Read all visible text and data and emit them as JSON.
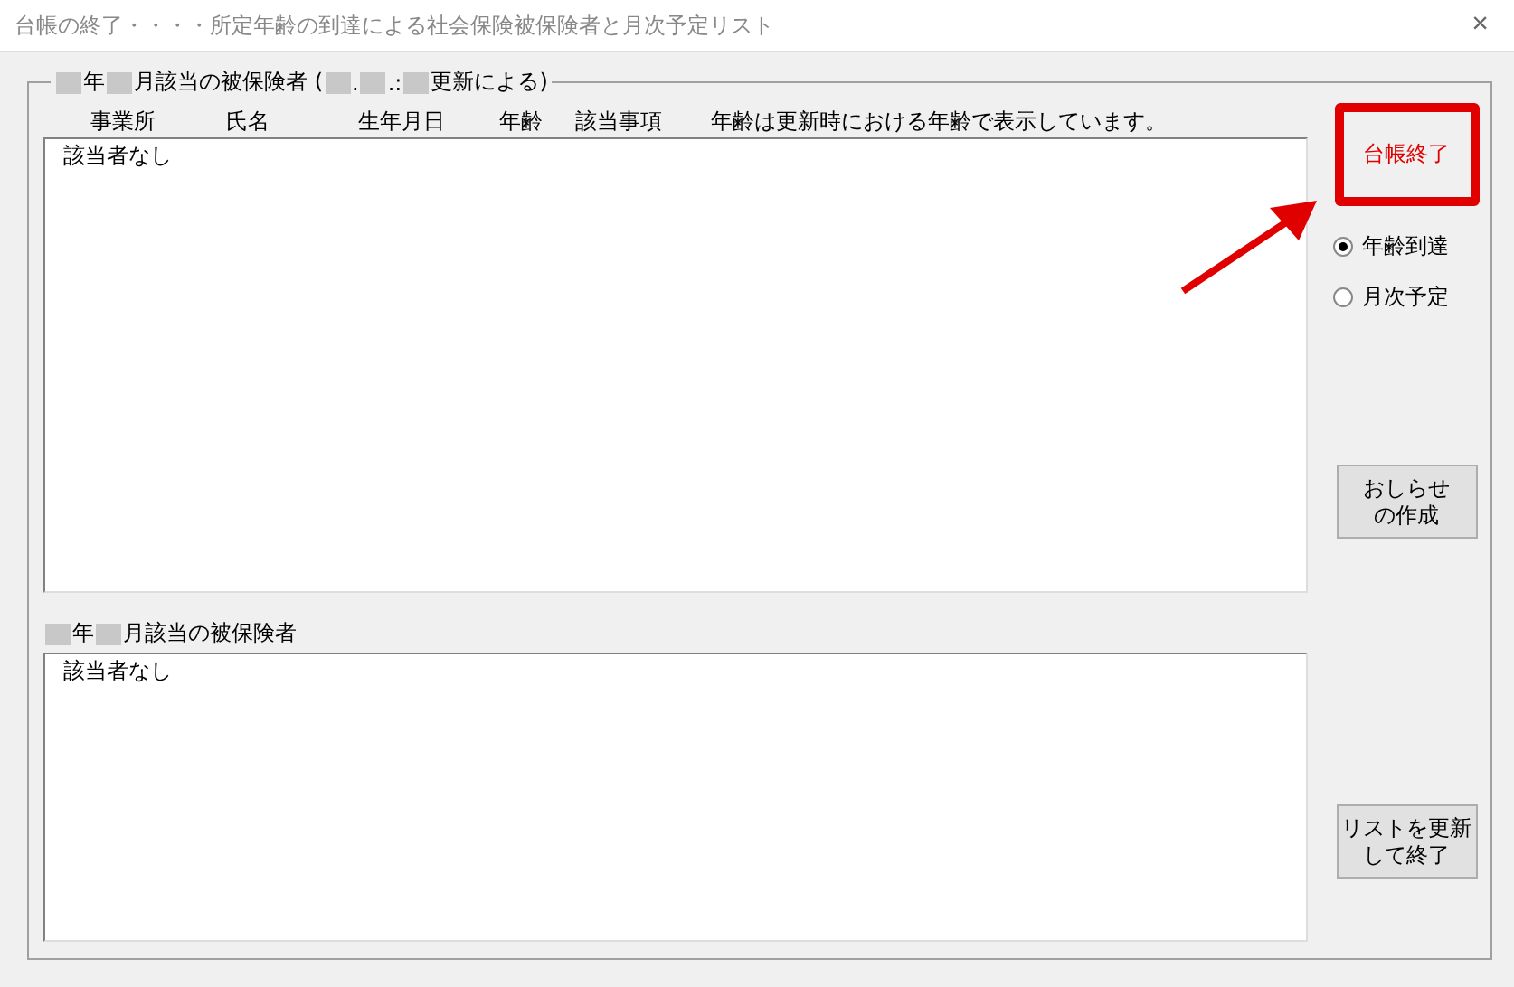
{
  "window": {
    "title": "台帳の終了・・・・所定年齢の到達による社会保険被保険者と月次予定リスト",
    "close": "×"
  },
  "upper_group": {
    "title_parts": [
      {
        "kind": "redacted"
      },
      {
        "kind": "text",
        "text": "年"
      },
      {
        "kind": "redacted"
      },
      {
        "kind": "text",
        "text": "月該当の被保険者 ("
      },
      {
        "kind": "redacted"
      },
      {
        "kind": "text",
        "text": "."
      },
      {
        "kind": "redacted"
      },
      {
        "kind": "text",
        "text": ".:"
      },
      {
        "kind": "redacted"
      },
      {
        "kind": "text",
        "text": "更新による)"
      }
    ],
    "columns": [
      "事業所",
      "氏名",
      "生年月日",
      "年齢",
      "該当事項"
    ],
    "note": "年齢は更新時における年齢で表示しています。",
    "list_items": [
      "該当者なし"
    ]
  },
  "lower_group": {
    "title_parts": [
      {
        "kind": "redacted"
      },
      {
        "kind": "text",
        "text": "年"
      },
      {
        "kind": "redacted"
      },
      {
        "kind": "text",
        "text": "月該当の被保険者"
      }
    ],
    "list_items": [
      "該当者なし"
    ]
  },
  "close_ledger_button": {
    "label": "台帳終了",
    "highlighted": true
  },
  "radios": [
    {
      "label": "年齢到達",
      "selected": true
    },
    {
      "label": "月次予定",
      "selected": false
    }
  ],
  "notice_button": {
    "label": "おしらせの作成"
  },
  "update_button": {
    "label": "リストを更新して終了"
  }
}
